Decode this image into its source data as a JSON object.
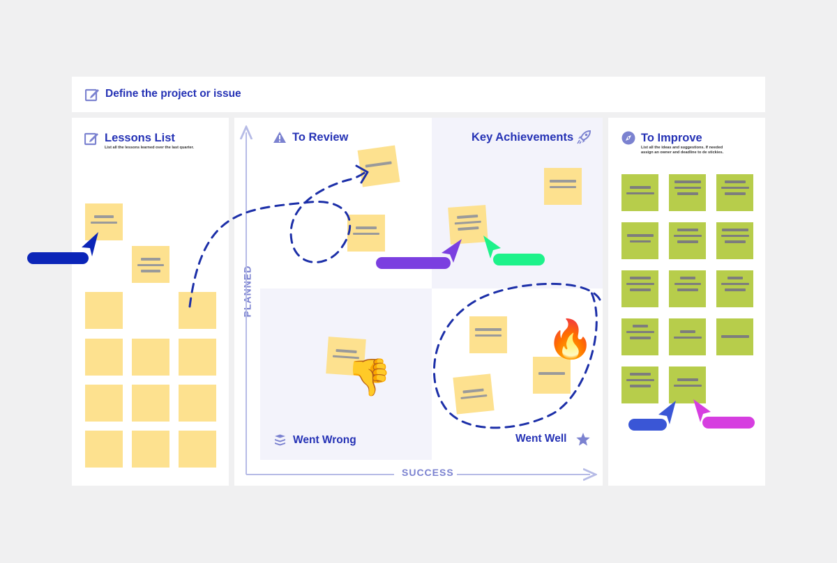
{
  "title_bar": {
    "title": "Define the project or issue"
  },
  "lessons": {
    "title": "Lessons List",
    "description": "List all the lessons learned over the last quarter."
  },
  "quadrants": {
    "to_review": "To Review",
    "key_achievements": "Key Achievements",
    "went_wrong": "Went Wrong",
    "went_well": "Went Well"
  },
  "axes": {
    "y_label": "PLANNED",
    "x_label": "SUCCESS"
  },
  "improve": {
    "title": "To Improve",
    "description_line1": "List all the ideas and suggestions. If needed",
    "description_line2": "assign an owner and deadline to de stickies."
  },
  "colors": {
    "heading": "#2532b5",
    "sticky_yellow": "#fde18f",
    "sticky_green": "#b7cd4b",
    "cursor_blue": "#0b25b8",
    "cursor_purple": "#7b3fe0",
    "cursor_green": "#1df28a",
    "cursor_royal": "#3a56d6",
    "cursor_magenta": "#d63ee0"
  },
  "icons": {
    "title": "pencil-icon",
    "lessons": "pencil-icon",
    "to_review": "warning-icon",
    "key_achievements": "rocket-icon",
    "went_wrong": "layers-icon",
    "went_well": "star-icon",
    "improve": "compass-icon"
  }
}
